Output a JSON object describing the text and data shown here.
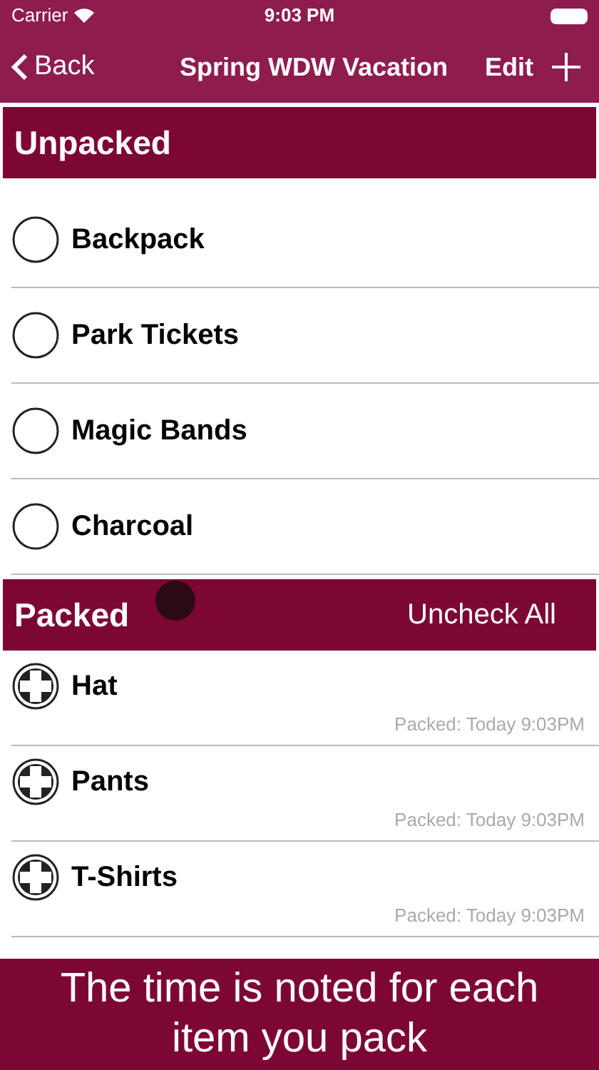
{
  "status_bar": {
    "carrier": "Carrier",
    "time": "9:03 PM"
  },
  "nav": {
    "back": "Back",
    "title": "Spring WDW Vacation",
    "edit": "Edit"
  },
  "sections": [
    {
      "title": "Unpacked",
      "items": [
        {
          "name": "Backpack",
          "checked": false
        },
        {
          "name": "Park Tickets",
          "checked": false
        },
        {
          "name": "Magic Bands",
          "checked": false
        },
        {
          "name": "Charcoal",
          "checked": false
        }
      ]
    },
    {
      "title": "Packed",
      "action": "Uncheck All",
      "items": [
        {
          "name": "Hat",
          "checked": true,
          "note": "Packed: Today 9:03PM"
        },
        {
          "name": "Pants",
          "checked": true,
          "note": "Packed: Today 9:03PM"
        },
        {
          "name": "T-Shirts",
          "checked": true,
          "note": "Packed: Today 9:03PM"
        }
      ]
    }
  ],
  "caption": "The time is noted for each item you pack"
}
